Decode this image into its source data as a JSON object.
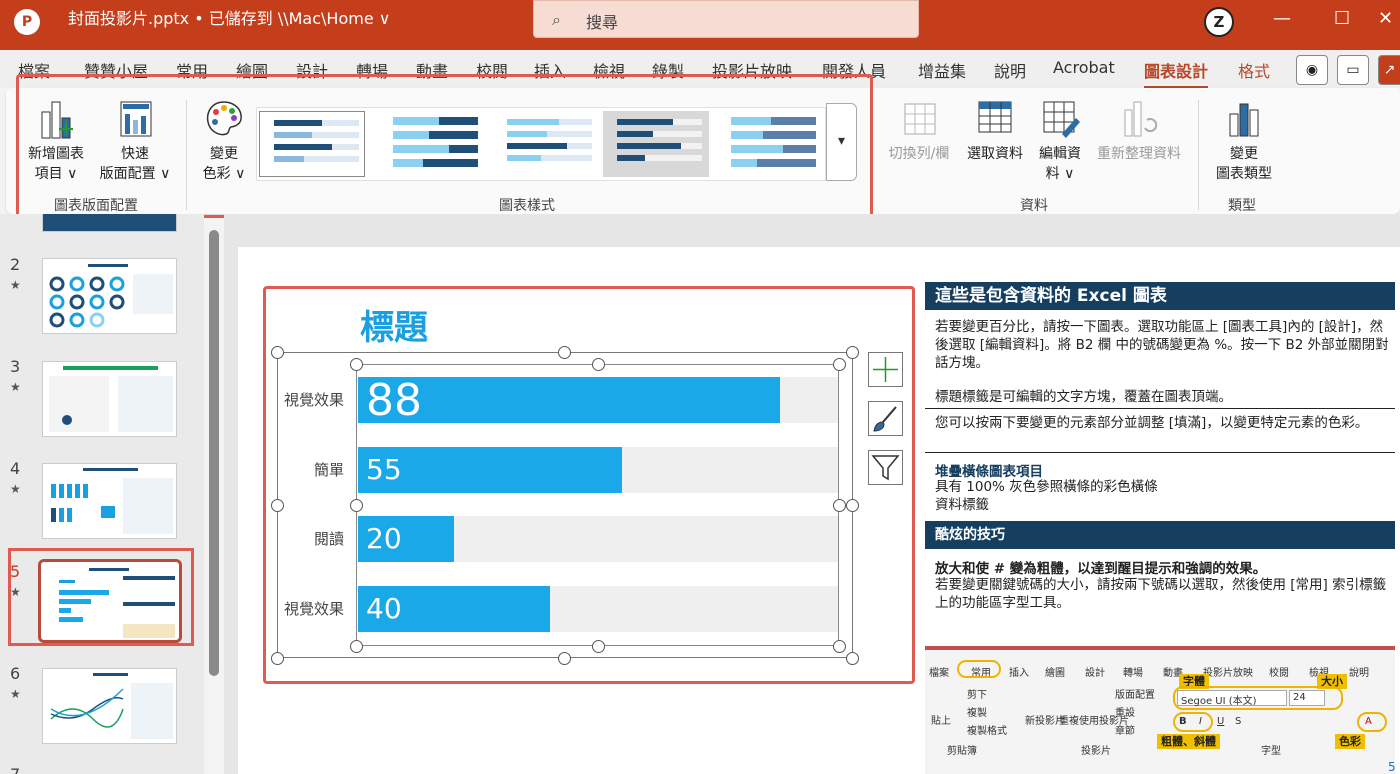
{
  "titlebar": {
    "app_icon": "P",
    "doc_title": "封面投影片.pptx • 已儲存到 \\\\Mac\\Home ∨",
    "search_placeholder": "搜尋",
    "avatar": "Z",
    "minimize": "—",
    "maximize": "☐",
    "close": "✕"
  },
  "tabs": [
    "檔案",
    "贊贊小屋",
    "常用",
    "繪圖",
    "設計",
    "轉場",
    "動畫",
    "校閱",
    "插入",
    "檢視",
    "錄製",
    "投影片放映",
    "開發人員",
    "增益集",
    "說明",
    "Acrobat",
    "圖表設計",
    "格式"
  ],
  "active_tab": "圖表設計",
  "ribbon": {
    "add_element": [
      "新增圖表",
      "項目 ∨"
    ],
    "quick_layout": [
      "快速",
      "版面配置 ∨"
    ],
    "group_layout": "圖表版面配置",
    "change_colors": [
      "變更",
      "色彩 ∨"
    ],
    "group_styles": "圖表樣式",
    "switch_row_col": "切換列/欄",
    "select_data": "選取資料",
    "edit_data": [
      "編輯資",
      "料 ∨"
    ],
    "refresh_data": "重新整理資料",
    "group_data": "資料",
    "change_type": [
      "變更",
      "圖表類型"
    ],
    "group_type": "類型",
    "more_styles": "▾"
  },
  "slides": [
    {
      "num": "2",
      "star": "★"
    },
    {
      "num": "3",
      "star": "★"
    },
    {
      "num": "4",
      "star": "★"
    },
    {
      "num": "5",
      "star": "★"
    },
    {
      "num": "6",
      "star": "★"
    },
    {
      "num": "7",
      "star": ""
    }
  ],
  "chart_data": {
    "type": "bar",
    "title": "標題",
    "categories": [
      "視覺效果",
      "簡單",
      "閱讀",
      "視覺效果"
    ],
    "values": [
      88,
      55,
      20,
      40
    ],
    "xlim": [
      0,
      100
    ],
    "series": [
      {
        "values": [
          88,
          55,
          20,
          40
        ],
        "color": "#1aa8e8"
      }
    ],
    "background_color": "#efefef"
  },
  "info": {
    "h1": "這些是包含資料的 Excel 圖表",
    "p1": "若要變更百分比，請按一下圖表。選取功能區上 [圖表工具]內的 [設計]，然後選取 [編輯資料]。將 B2 欄 中的號碼變更為 %。按一下 B2 外部並關閉對話方塊。",
    "p2": "標題標籤是可編輯的文字方塊，覆蓋在圖表頂端。",
    "p3": "您可以按兩下要變更的元素部分並調整 [填滿]，以變更特定元素的色彩。",
    "sub1": "堆疊橫條圖表項目",
    "p4a": "具有 100% 灰色參照橫條的彩色橫條",
    "p4b": "資料標籤",
    "h2": "酷炫的技巧",
    "p5": "放大和使 # 變為粗體，以達到醒目提示和強調的效果。",
    "p6": "若要變更關鍵號碼的大小，請按兩下號碼以選取，然後使用 [常用] 索引標籤上的功能區字型工具。"
  },
  "mini_ribbon": {
    "tabs": [
      "檔案",
      "常用",
      "插入",
      "繪圖",
      "設計",
      "轉場",
      "動畫",
      "投影片放映",
      "校閱",
      "檢視",
      "說明"
    ],
    "font_label": "字體",
    "size_label": "大小",
    "font_value": "Segoe UI (本文)",
    "size_value": "24",
    "bold_italic_label": "粗體、斜體",
    "color_label": "色彩",
    "cut": "剪下",
    "copy": "複製",
    "format_painter": "複製格式",
    "paste": "貼上",
    "new_slide": "新投影片",
    "reuse_slide": "重複使用投影片",
    "layout": "版面配置",
    "reset": "重設",
    "section": "章節",
    "group_clipboard": "剪貼簿",
    "group_slides": "投影片",
    "group_font": "字型"
  },
  "page_number": "5"
}
